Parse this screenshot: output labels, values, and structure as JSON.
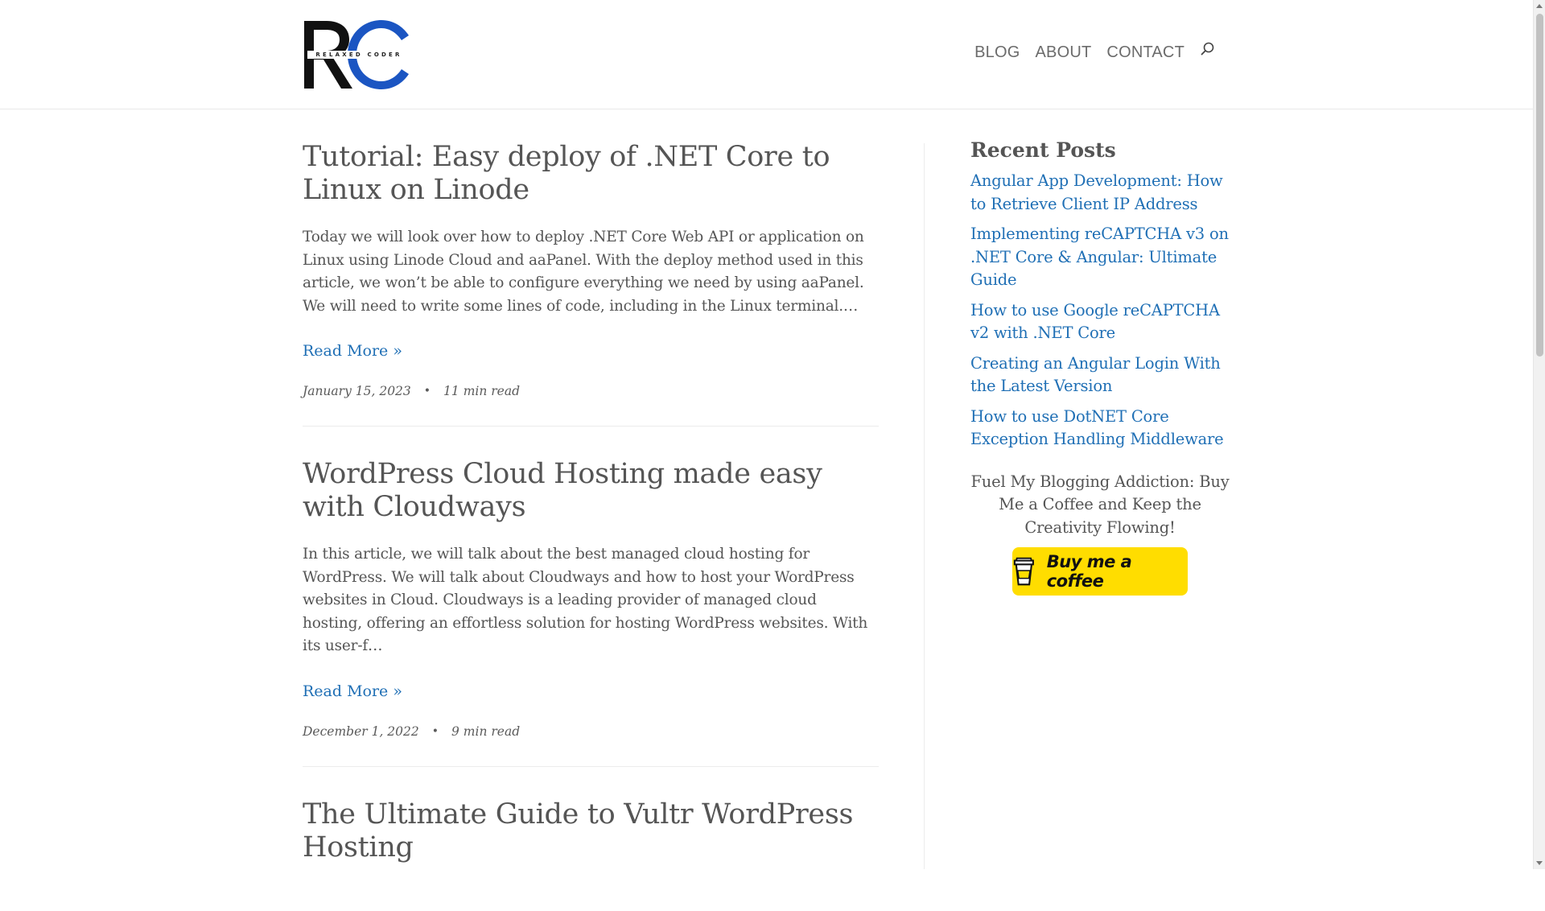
{
  "header": {
    "logo_tagline": "RELAXED CODER",
    "nav": [
      {
        "label": "BLOG"
      },
      {
        "label": "ABOUT"
      },
      {
        "label": "CONTACT"
      }
    ],
    "search_icon": "search-icon"
  },
  "posts": [
    {
      "title": "Tutorial: Easy deploy of .NET Core to Linux on Linode",
      "excerpt": "Today we will look over how to deploy .NET Core Web API or application on Linux using Linode Cloud and aaPanel. With the deploy method used in this article, we won’t be able to configure everything we need by using aaPanel. We will need to write some lines of code, including in the Linux terminal.…",
      "read_more": "Read More »",
      "date": "January 15, 2023",
      "read_time": "11 min read"
    },
    {
      "title": "WordPress Cloud Hosting made easy with Cloudways",
      "excerpt": "In this article, we will talk about the best managed cloud hosting for WordPress. We will talk about Cloudways and how to host your WordPress websites in Cloud. Cloudways is a leading provider of managed cloud hosting, offering an effortless solution for hosting WordPress websites. With its user-f…",
      "read_more": "Read More »",
      "date": "December 1, 2022",
      "read_time": "9 min read"
    },
    {
      "title": "The Ultimate Guide to Vultr WordPress Hosting"
    }
  ],
  "sidebar": {
    "recent_title": "Recent Posts",
    "recent_posts": [
      {
        "label": "Angular App Development: How to Retrieve Client IP Address"
      },
      {
        "label": "Implementing reCAPTCHA v3 on .NET Core & Angular: Ultimate Guide"
      },
      {
        "label": "How to use Google reCAPTCHA v2 with .NET Core"
      },
      {
        "label": "Creating an Angular Login With the Latest Version"
      },
      {
        "label": "How to use DotNET Core Exception Handling Middleware"
      }
    ],
    "coffee_text": "Fuel My Blogging Addiction: Buy Me a Coffee and Keep the Creativity Flowing!",
    "coffee_button": "Buy me a coffee",
    "coffee_icon": "coffee-cup-icon"
  },
  "colors": {
    "link": "#1f6fb5",
    "text": "#555555",
    "coffee_bg": "#ffdd00",
    "logo_blue": "#1b55c2"
  }
}
